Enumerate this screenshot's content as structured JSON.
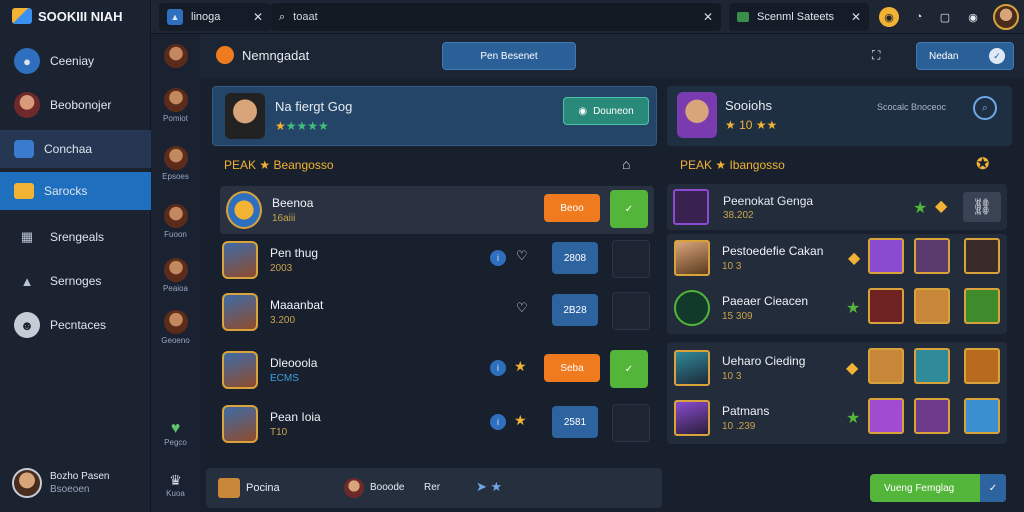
{
  "sidebar": {
    "brand": "SOOKIII NIAH",
    "items": [
      {
        "label": "Ceeniay",
        "icon": "person-icon"
      },
      {
        "label": "Beobonojer",
        "icon": "avatar-icon"
      },
      {
        "label": "Conchaa",
        "icon": "window-icon"
      },
      {
        "label": "Sarocks",
        "icon": "folder-icon"
      },
      {
        "label": "Srengeals",
        "icon": "grid-icon"
      },
      {
        "label": "Sernoges",
        "icon": "stack-icon"
      },
      {
        "label": "Pecntaces",
        "icon": "smiley-icon"
      }
    ],
    "user": {
      "name": "Bozho Pasen",
      "sub": "Bsoeoen"
    }
  },
  "rail": {
    "items": [
      "Pomiot",
      "Epsoes",
      "Fuoon",
      "Peaioa",
      "Geoeno",
      "Pegco",
      "Kuoa"
    ]
  },
  "topbar": {
    "tab1": "linoga",
    "search_placeholder": "toaat",
    "tab3": "Scenml Sateets"
  },
  "subbar": {
    "title": "Nemngadat",
    "center_button": "Pen Besenet",
    "right_button": "Nedan"
  },
  "left_panel": {
    "player_name": "Na fiergt Gog",
    "header_button": "Douneon",
    "section_title": "PEAK ★ Beangosso",
    "rows": [
      {
        "name": "Beenoa",
        "sub": "16aiii",
        "action": "Beoo"
      },
      {
        "name": "Pen thug",
        "sub": "2003",
        "action": "2808"
      },
      {
        "name": "Maaanbat",
        "sub": "3.200",
        "action": "2B28"
      },
      {
        "name": "Dleooola",
        "sub": "ECMS",
        "action": "Seba"
      },
      {
        "name": "Pean Ioia",
        "sub": "T10",
        "action": "2581"
      }
    ]
  },
  "right_panel": {
    "player_name": "Sooiohs",
    "player_sub": "10",
    "header_note": "Scocalc Bnoceoc",
    "section_title": "PEAK ★ Ibangosso",
    "rows": [
      {
        "name": "Peenokat Genga",
        "sub": "38.202"
      },
      {
        "name": "Pestoedefie Cakan",
        "sub": "10 3"
      },
      {
        "name": "Paeaer Cieacen",
        "sub": "15 309"
      },
      {
        "name": "Ueharo Cieding",
        "sub": "10 3"
      },
      {
        "name": "Patmans",
        "sub": "10 .239"
      }
    ]
  },
  "bottom": {
    "item1": "Pocina",
    "item2": "Booode",
    "item3": "Rer",
    "action": "Vueng Femglag"
  },
  "colors": {
    "accent": "#1f6fbf",
    "orange": "#f07a1e",
    "green": "#53b53a",
    "gold": "#d9a33c"
  }
}
